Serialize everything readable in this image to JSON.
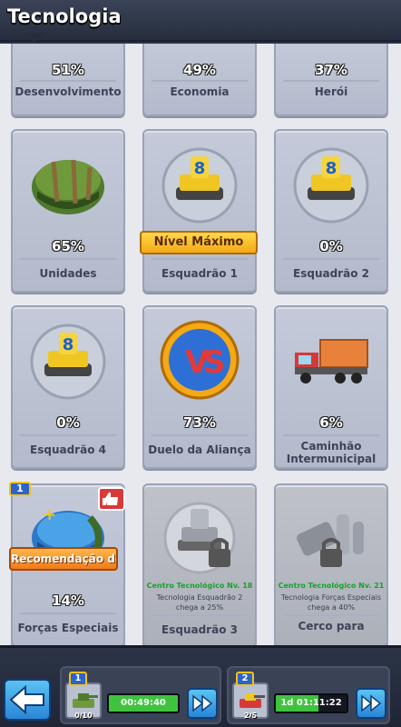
{
  "header": {
    "title": "Tecnologia"
  },
  "top_row": [
    {
      "pct": "51%",
      "name": "Desenvolvimento"
    },
    {
      "pct": "49%",
      "name": "Economia"
    },
    {
      "pct": "37%",
      "name": "Herói"
    }
  ],
  "row2": [
    {
      "pct": "65%",
      "name": "Unidades",
      "icon": "helmet-icon"
    },
    {
      "pct": "",
      "name": "Esquadrão 1",
      "icon": "tank-icon",
      "badge": "Nível Máximo"
    },
    {
      "pct": "0%",
      "name": "Esquadrão 2",
      "icon": "tank-icon"
    }
  ],
  "row3": [
    {
      "pct": "0%",
      "name": "Esquadrão 4",
      "icon": "tank-icon"
    },
    {
      "pct": "73%",
      "name": "Duelo da Aliança",
      "icon": "vs-icon"
    },
    {
      "pct": "6%",
      "name": "Caminhão\nIntermunicipal",
      "icon": "truck-icon"
    }
  ],
  "row4": [
    {
      "pct": "14%",
      "name": "Forças Especiais",
      "icon": "helmet-icon",
      "level_badge": "1",
      "recommend": "Recomendação de"
    },
    {
      "requirement": "Centro Tecnológico Nv. 18",
      "desc": "Tecnologia Esquadrão 2 chega a 25%",
      "name": "Esquadrão 3",
      "icon": "locked-tank-icon"
    },
    {
      "requirement": "Centro Tecnológico Nv. 21",
      "desc": "Tecnologia Forças Especiais chega a 40%",
      "name": "Cerco para",
      "icon": "locked-siege-icon"
    }
  ],
  "footer": {
    "queue1": {
      "level": "1",
      "count": "0/10",
      "timer": "00:49:40",
      "progress": 1.0
    },
    "queue2": {
      "level": "2",
      "count": "2/5",
      "timer": "1d 01:11:22",
      "progress": 0.6
    }
  },
  "colors": {
    "accent_blue": "#2a86d6",
    "gold": "#f4a915",
    "progress_green": "#3fc33f",
    "requirement_green": "#15a32c"
  }
}
